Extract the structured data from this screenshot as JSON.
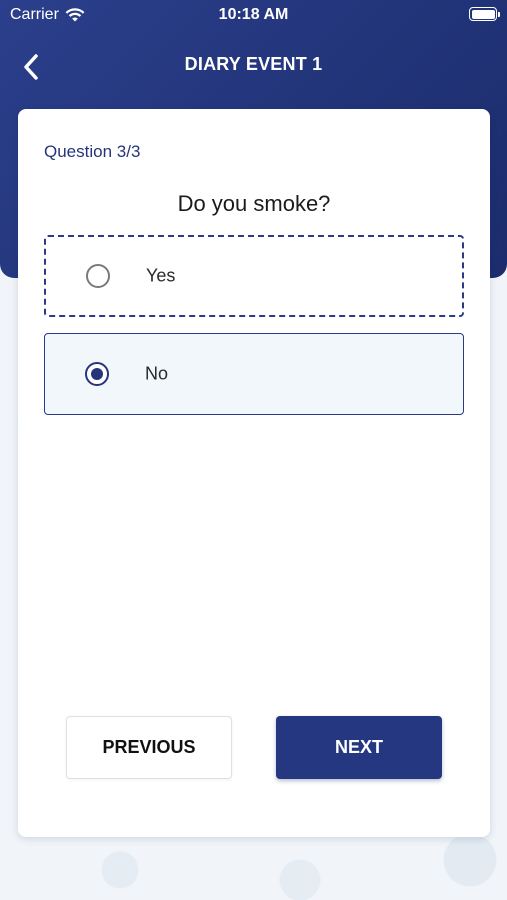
{
  "status_bar": {
    "carrier": "Carrier",
    "time": "10:18 AM",
    "icons": [
      "wifi-icon",
      "battery-icon"
    ]
  },
  "nav": {
    "title": "DIARY EVENT 1",
    "back_icon": "chevron-left-icon"
  },
  "question": {
    "counter": "Question 3/3",
    "text": "Do you smoke?",
    "options": [
      {
        "label": "Yes",
        "selected": false
      },
      {
        "label": "No",
        "selected": true
      }
    ]
  },
  "buttons": {
    "previous": "PREVIOUS",
    "next": "NEXT"
  },
  "colors": {
    "header": "#223479",
    "accent": "#26357a",
    "next_button": "#243780",
    "selected_option_bg": "#f2f7fc"
  }
}
